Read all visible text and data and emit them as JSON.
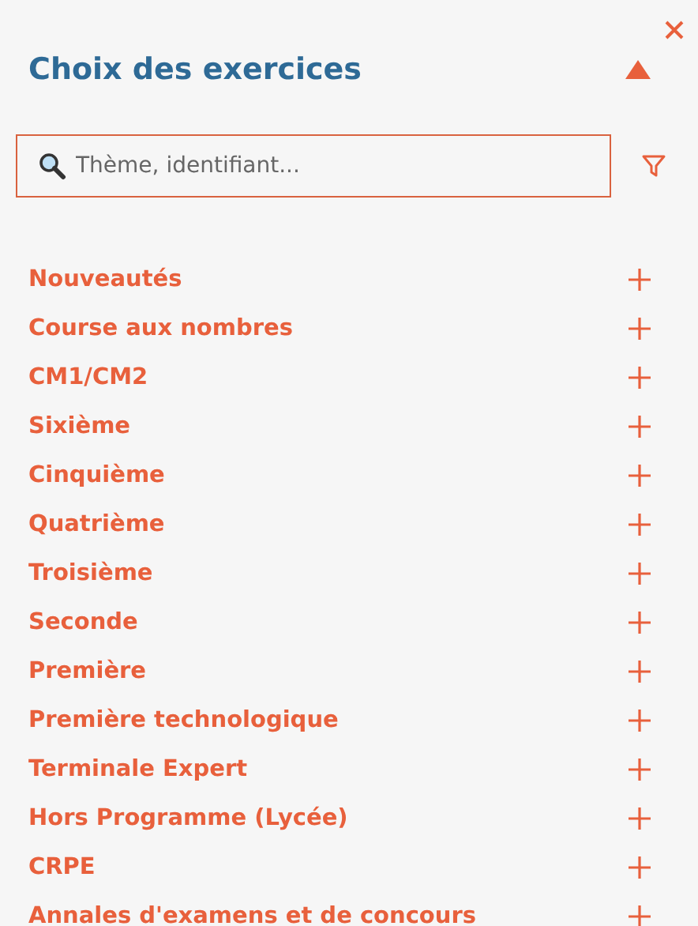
{
  "panel": {
    "title": "Choix des exercices",
    "expanded": true
  },
  "search": {
    "placeholder": "Thème, identifiant..."
  },
  "categories": [
    {
      "label": "Nouveautés",
      "expanded": false
    },
    {
      "label": "Course aux nombres",
      "expanded": false
    },
    {
      "label": "CM1/CM2",
      "expanded": false
    },
    {
      "label": "Sixième",
      "expanded": false
    },
    {
      "label": "Cinquième",
      "expanded": false
    },
    {
      "label": "Quatrième",
      "expanded": false
    },
    {
      "label": "Troisième",
      "expanded": false
    },
    {
      "label": "Seconde",
      "expanded": false
    },
    {
      "label": "Première",
      "expanded": false
    },
    {
      "label": "Première technologique",
      "expanded": false
    },
    {
      "label": "Terminale Expert",
      "expanded": false
    },
    {
      "label": "Hors Programme (Lycée)",
      "expanded": false
    },
    {
      "label": "CRPE",
      "expanded": false
    },
    {
      "label": "Annales d'examens et de concours",
      "expanded": false
    }
  ]
}
